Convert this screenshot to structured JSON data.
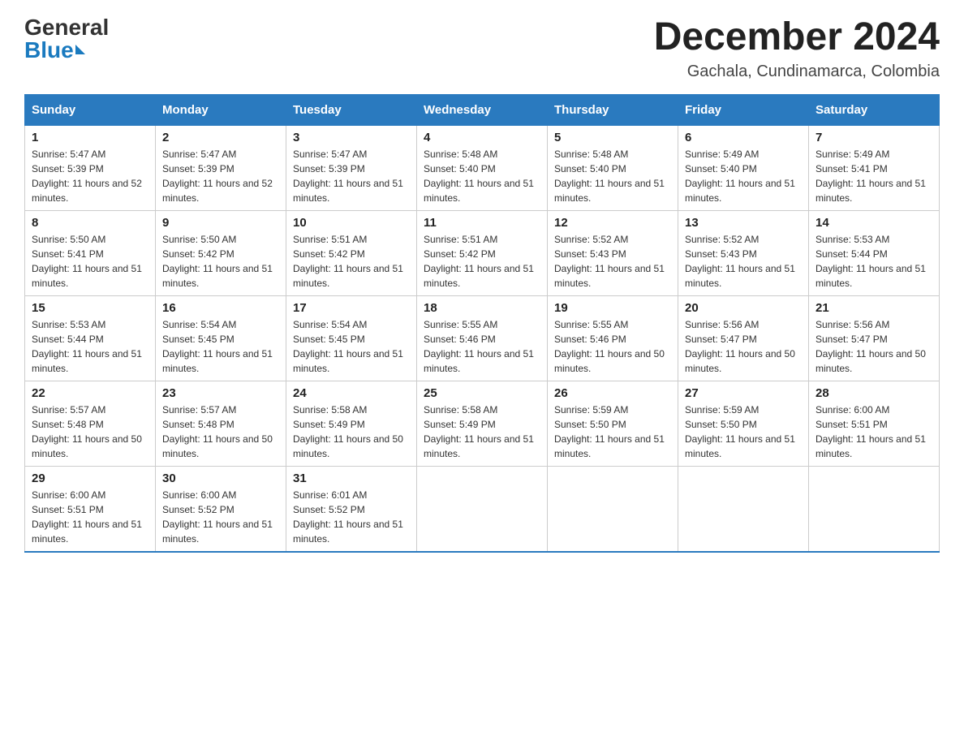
{
  "logo": {
    "general": "General",
    "blue": "Blue"
  },
  "header": {
    "month_year": "December 2024",
    "location": "Gachala, Cundinamarca, Colombia"
  },
  "days_of_week": [
    "Sunday",
    "Monday",
    "Tuesday",
    "Wednesday",
    "Thursday",
    "Friday",
    "Saturday"
  ],
  "weeks": [
    [
      {
        "day": "1",
        "sunrise": "5:47 AM",
        "sunset": "5:39 PM",
        "daylight": "11 hours and 52 minutes."
      },
      {
        "day": "2",
        "sunrise": "5:47 AM",
        "sunset": "5:39 PM",
        "daylight": "11 hours and 52 minutes."
      },
      {
        "day": "3",
        "sunrise": "5:47 AM",
        "sunset": "5:39 PM",
        "daylight": "11 hours and 51 minutes."
      },
      {
        "day": "4",
        "sunrise": "5:48 AM",
        "sunset": "5:40 PM",
        "daylight": "11 hours and 51 minutes."
      },
      {
        "day": "5",
        "sunrise": "5:48 AM",
        "sunset": "5:40 PM",
        "daylight": "11 hours and 51 minutes."
      },
      {
        "day": "6",
        "sunrise": "5:49 AM",
        "sunset": "5:40 PM",
        "daylight": "11 hours and 51 minutes."
      },
      {
        "day": "7",
        "sunrise": "5:49 AM",
        "sunset": "5:41 PM",
        "daylight": "11 hours and 51 minutes."
      }
    ],
    [
      {
        "day": "8",
        "sunrise": "5:50 AM",
        "sunset": "5:41 PM",
        "daylight": "11 hours and 51 minutes."
      },
      {
        "day": "9",
        "sunrise": "5:50 AM",
        "sunset": "5:42 PM",
        "daylight": "11 hours and 51 minutes."
      },
      {
        "day": "10",
        "sunrise": "5:51 AM",
        "sunset": "5:42 PM",
        "daylight": "11 hours and 51 minutes."
      },
      {
        "day": "11",
        "sunrise": "5:51 AM",
        "sunset": "5:42 PM",
        "daylight": "11 hours and 51 minutes."
      },
      {
        "day": "12",
        "sunrise": "5:52 AM",
        "sunset": "5:43 PM",
        "daylight": "11 hours and 51 minutes."
      },
      {
        "day": "13",
        "sunrise": "5:52 AM",
        "sunset": "5:43 PM",
        "daylight": "11 hours and 51 minutes."
      },
      {
        "day": "14",
        "sunrise": "5:53 AM",
        "sunset": "5:44 PM",
        "daylight": "11 hours and 51 minutes."
      }
    ],
    [
      {
        "day": "15",
        "sunrise": "5:53 AM",
        "sunset": "5:44 PM",
        "daylight": "11 hours and 51 minutes."
      },
      {
        "day": "16",
        "sunrise": "5:54 AM",
        "sunset": "5:45 PM",
        "daylight": "11 hours and 51 minutes."
      },
      {
        "day": "17",
        "sunrise": "5:54 AM",
        "sunset": "5:45 PM",
        "daylight": "11 hours and 51 minutes."
      },
      {
        "day": "18",
        "sunrise": "5:55 AM",
        "sunset": "5:46 PM",
        "daylight": "11 hours and 51 minutes."
      },
      {
        "day": "19",
        "sunrise": "5:55 AM",
        "sunset": "5:46 PM",
        "daylight": "11 hours and 50 minutes."
      },
      {
        "day": "20",
        "sunrise": "5:56 AM",
        "sunset": "5:47 PM",
        "daylight": "11 hours and 50 minutes."
      },
      {
        "day": "21",
        "sunrise": "5:56 AM",
        "sunset": "5:47 PM",
        "daylight": "11 hours and 50 minutes."
      }
    ],
    [
      {
        "day": "22",
        "sunrise": "5:57 AM",
        "sunset": "5:48 PM",
        "daylight": "11 hours and 50 minutes."
      },
      {
        "day": "23",
        "sunrise": "5:57 AM",
        "sunset": "5:48 PM",
        "daylight": "11 hours and 50 minutes."
      },
      {
        "day": "24",
        "sunrise": "5:58 AM",
        "sunset": "5:49 PM",
        "daylight": "11 hours and 50 minutes."
      },
      {
        "day": "25",
        "sunrise": "5:58 AM",
        "sunset": "5:49 PM",
        "daylight": "11 hours and 51 minutes."
      },
      {
        "day": "26",
        "sunrise": "5:59 AM",
        "sunset": "5:50 PM",
        "daylight": "11 hours and 51 minutes."
      },
      {
        "day": "27",
        "sunrise": "5:59 AM",
        "sunset": "5:50 PM",
        "daylight": "11 hours and 51 minutes."
      },
      {
        "day": "28",
        "sunrise": "6:00 AM",
        "sunset": "5:51 PM",
        "daylight": "11 hours and 51 minutes."
      }
    ],
    [
      {
        "day": "29",
        "sunrise": "6:00 AM",
        "sunset": "5:51 PM",
        "daylight": "11 hours and 51 minutes."
      },
      {
        "day": "30",
        "sunrise": "6:00 AM",
        "sunset": "5:52 PM",
        "daylight": "11 hours and 51 minutes."
      },
      {
        "day": "31",
        "sunrise": "6:01 AM",
        "sunset": "5:52 PM",
        "daylight": "11 hours and 51 minutes."
      },
      null,
      null,
      null,
      null
    ]
  ],
  "labels": {
    "sunrise": "Sunrise:",
    "sunset": "Sunset:",
    "daylight": "Daylight:"
  }
}
